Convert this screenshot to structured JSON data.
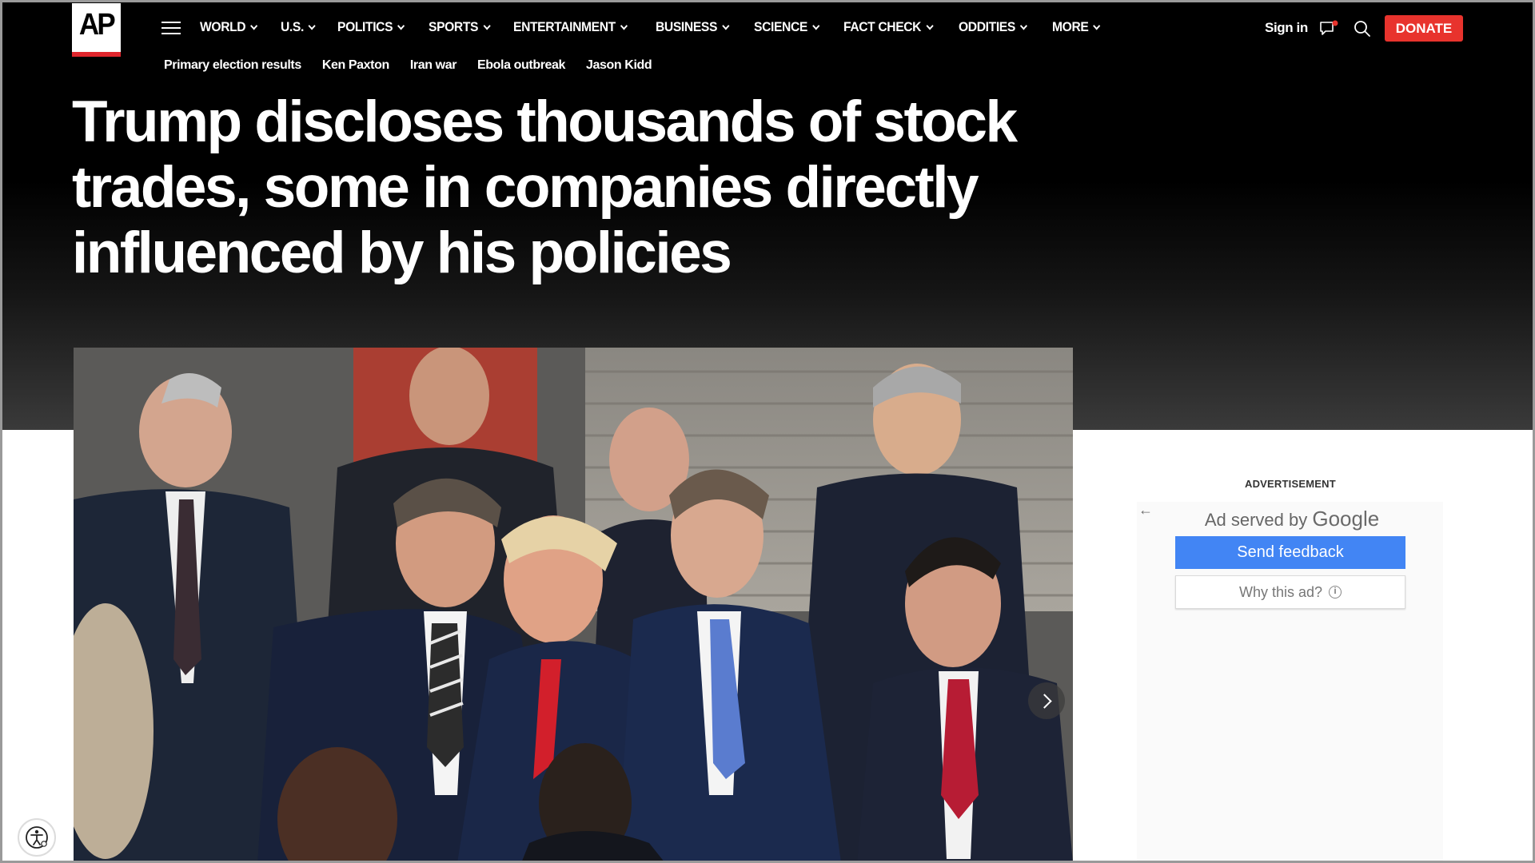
{
  "brand": {
    "logo": "AP",
    "accent": "#e0262d"
  },
  "nav": {
    "items": [
      {
        "label": "WORLD"
      },
      {
        "label": "U.S."
      },
      {
        "label": "POLITICS"
      },
      {
        "label": "SPORTS"
      },
      {
        "label": "ENTERTAINMENT"
      },
      {
        "label": "BUSINESS"
      },
      {
        "label": "SCIENCE"
      },
      {
        "label": "FACT CHECK"
      },
      {
        "label": "ODDITIES"
      },
      {
        "label": "MORE"
      }
    ],
    "sign_in": "Sign in",
    "donate": "DONATE",
    "donate_color": "#e8332d"
  },
  "trending": [
    "Primary election results",
    "Ken Paxton",
    "Iran war",
    "Ebola outbreak",
    "Jason Kidd"
  ],
  "article": {
    "headline": "Trump discloses thousands of stock trades, some in companies directly influenced by his policies"
  },
  "ad": {
    "label": "ADVERTISEMENT",
    "served_by": "Ad served by",
    "google": "Google",
    "send_feedback": "Send feedback",
    "why_this_ad": "Why this ad?",
    "feedback_color": "#4285f4"
  }
}
